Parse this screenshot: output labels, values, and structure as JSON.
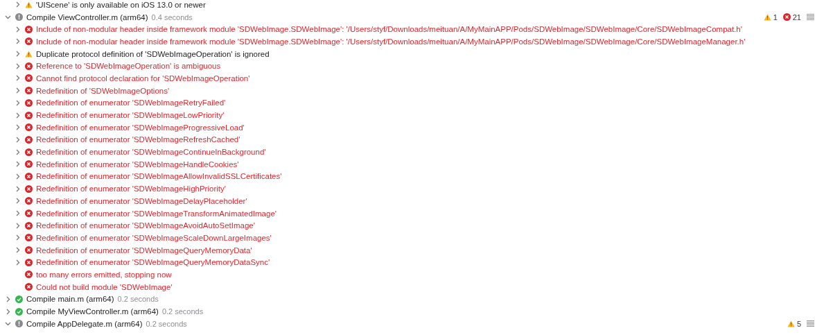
{
  "log": [
    {
      "kind": "warning",
      "text": "'UIScene' is only available on iOS 13.0 or newer",
      "expandable": true
    },
    {
      "kind": "group",
      "succeeded": false,
      "title": "Compile ViewController.m (arm64)",
      "duration": "0.4 seconds",
      "expanded": true,
      "warning_count": "1",
      "error_count": "21",
      "children": [
        {
          "kind": "error",
          "text": "Include of non-modular header inside framework module 'SDWebImage.SDWebImage': '/Users/styf/Downloads/meituan/A/MyMainAPP/Pods/SDWebImage/SDWebImage/Core/SDWebImageCompat.h'",
          "expandable": true
        },
        {
          "kind": "error",
          "text": "Include of non-modular header inside framework module 'SDWebImage.SDWebImage': '/Users/styf/Downloads/meituan/A/MyMainAPP/Pods/SDWebImage/SDWebImage/Core/SDWebImageManager.h'",
          "expandable": true
        },
        {
          "kind": "warning",
          "text": "Duplicate protocol definition of 'SDWebImageOperation' is ignored",
          "expandable": true
        },
        {
          "kind": "error",
          "text": "Reference to 'SDWebImageOperation' is ambiguous",
          "expandable": true
        },
        {
          "kind": "error",
          "text": "Cannot find protocol declaration for 'SDWebImageOperation'",
          "expandable": true
        },
        {
          "kind": "error",
          "text": "Redefinition of 'SDWebImageOptions'",
          "expandable": true
        },
        {
          "kind": "error",
          "text": "Redefinition of enumerator 'SDWebImageRetryFailed'",
          "expandable": true
        },
        {
          "kind": "error",
          "text": "Redefinition of enumerator 'SDWebImageLowPriority'",
          "expandable": true
        },
        {
          "kind": "error",
          "text": "Redefinition of enumerator 'SDWebImageProgressiveLoad'",
          "expandable": true
        },
        {
          "kind": "error",
          "text": "Redefinition of enumerator 'SDWebImageRefreshCached'",
          "expandable": true
        },
        {
          "kind": "error",
          "text": "Redefinition of enumerator 'SDWebImageContinueInBackground'",
          "expandable": true
        },
        {
          "kind": "error",
          "text": "Redefinition of enumerator 'SDWebImageHandleCookies'",
          "expandable": true
        },
        {
          "kind": "error",
          "text": "Redefinition of enumerator 'SDWebImageAllowInvalidSSLCertificates'",
          "expandable": true
        },
        {
          "kind": "error",
          "text": "Redefinition of enumerator 'SDWebImageHighPriority'",
          "expandable": true
        },
        {
          "kind": "error",
          "text": "Redefinition of enumerator 'SDWebImageDelayPlaceholder'",
          "expandable": true
        },
        {
          "kind": "error",
          "text": "Redefinition of enumerator 'SDWebImageTransformAnimatedImage'",
          "expandable": true
        },
        {
          "kind": "error",
          "text": "Redefinition of enumerator 'SDWebImageAvoidAutoSetImage'",
          "expandable": true
        },
        {
          "kind": "error",
          "text": "Redefinition of enumerator 'SDWebImageScaleDownLargeImages'",
          "expandable": true
        },
        {
          "kind": "error",
          "text": "Redefinition of enumerator 'SDWebImageQueryMemoryData'",
          "expandable": true
        },
        {
          "kind": "error",
          "text": "Redefinition of enumerator 'SDWebImageQueryMemoryDataSync'",
          "expandable": true
        },
        {
          "kind": "error",
          "text": "too many errors emitted, stopping now",
          "expandable": false
        },
        {
          "kind": "error",
          "text": "Could not build module 'SDWebImage'",
          "expandable": false
        }
      ]
    },
    {
      "kind": "group",
      "succeeded": true,
      "title": "Compile main.m (arm64)",
      "duration": "0.2 seconds",
      "expanded": false
    },
    {
      "kind": "group",
      "succeeded": true,
      "title": "Compile MyViewController.m (arm64)",
      "duration": "0.2 seconds",
      "expanded": false
    },
    {
      "kind": "group",
      "succeeded": false,
      "title": "Compile AppDelegate.m (arm64)",
      "duration": "0.2 seconds",
      "expanded": true,
      "warning_count": "5"
    }
  ]
}
